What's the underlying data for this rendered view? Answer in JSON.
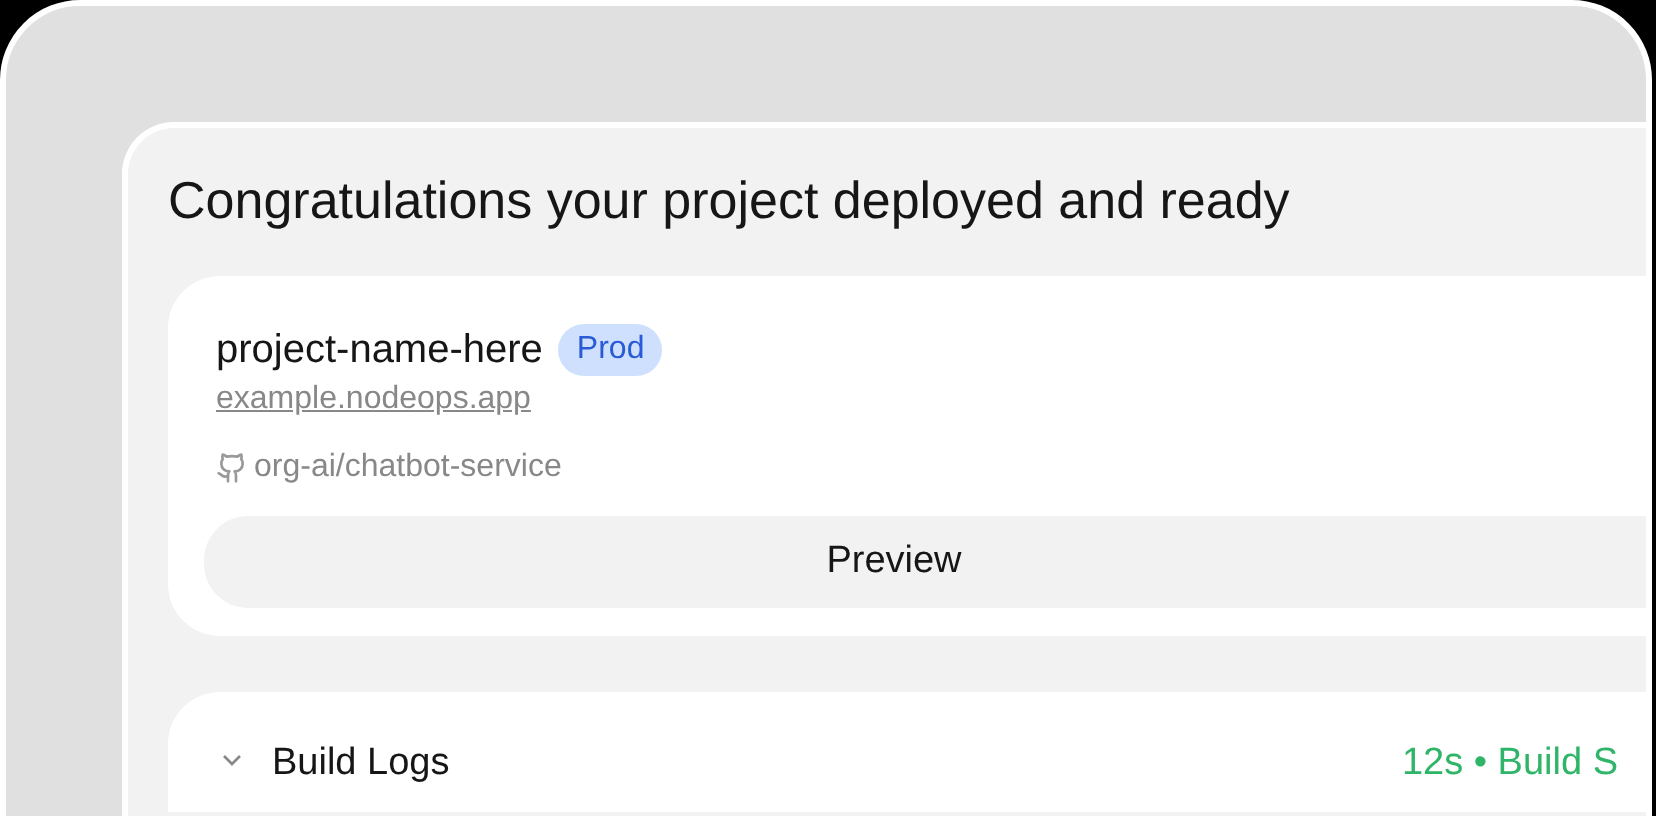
{
  "title": "Congratulations your project deployed and ready",
  "project": {
    "name": "project-name-here",
    "badge": "Prod",
    "url": "example.nodeops.app",
    "repo": "org-ai/chatbot-service",
    "button": "Preview"
  },
  "build_logs": {
    "label": "Build Logs",
    "expanded": false,
    "status": "12s • Build S"
  }
}
